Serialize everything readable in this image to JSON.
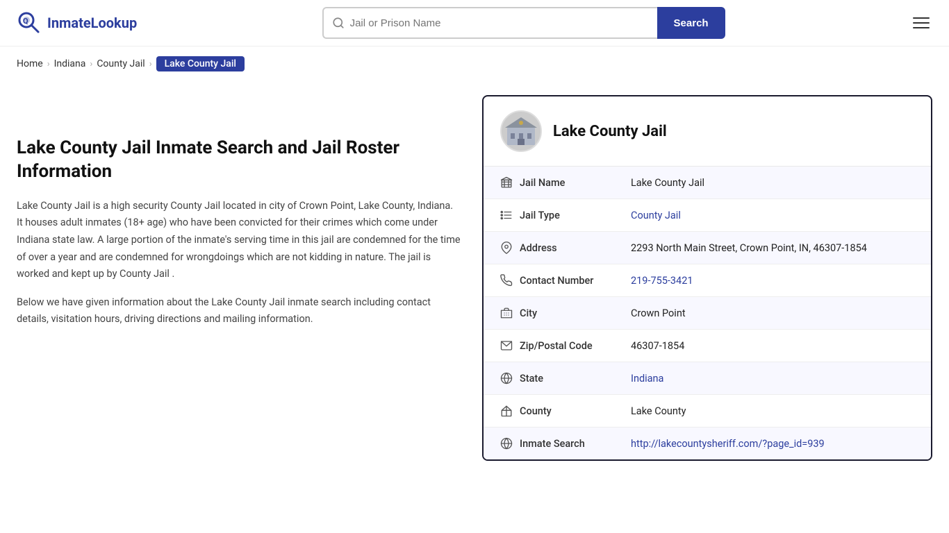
{
  "header": {
    "logo_text": "InmateLookup",
    "search_placeholder": "Jail or Prison Name",
    "search_button_label": "Search"
  },
  "breadcrumb": {
    "home": "Home",
    "indiana": "Indiana",
    "county_jail": "County Jail",
    "current": "Lake County Jail"
  },
  "left": {
    "heading": "Lake County Jail Inmate Search and Jail Roster Information",
    "description1": "Lake County Jail is a high security County Jail located in city of Crown Point, Lake County, Indiana. It houses adult inmates (18+ age) who have been convicted for their crimes which come under Indiana state law. A large portion of the inmate's serving time in this jail are condemned for the time of over a year and are condemned for wrongdoings which are not kidding in nature. The jail is worked and kept up by County Jail .",
    "description2": "Below we have given information about the Lake County Jail inmate search including contact details, visitation hours, driving directions and mailing information."
  },
  "card": {
    "jail_name_header": "Lake County Jail",
    "rows": [
      {
        "icon": "building-icon",
        "label": "Jail Name",
        "value": "Lake County Jail",
        "link": null
      },
      {
        "icon": "list-icon",
        "label": "Jail Type",
        "value": "County Jail",
        "link": "#"
      },
      {
        "icon": "location-icon",
        "label": "Address",
        "value": "2293 North Main Street, Crown Point, IN, 46307-1854",
        "link": null
      },
      {
        "icon": "phone-icon",
        "label": "Contact Number",
        "value": "219-755-3421",
        "link": "tel:219-755-3421"
      },
      {
        "icon": "city-icon",
        "label": "City",
        "value": "Crown Point",
        "link": null
      },
      {
        "icon": "mail-icon",
        "label": "Zip/Postal Code",
        "value": "46307-1854",
        "link": null
      },
      {
        "icon": "globe-icon",
        "label": "State",
        "value": "Indiana",
        "link": "#"
      },
      {
        "icon": "flag-icon",
        "label": "County",
        "value": "Lake County",
        "link": null
      },
      {
        "icon": "search-globe-icon",
        "label": "Inmate Search",
        "value": "http://lakecountysheriff.com/?page_id=939",
        "link": "http://lakecountysheriff.com/?page_id=939"
      }
    ]
  }
}
